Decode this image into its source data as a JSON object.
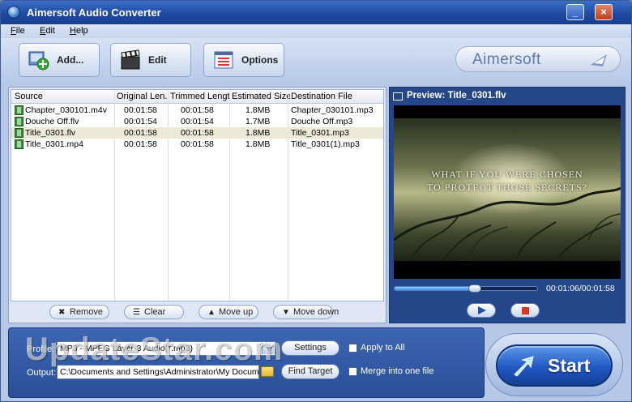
{
  "window": {
    "title": "Aimersoft Audio Converter"
  },
  "menu": [
    "File",
    "Edit",
    "Help"
  ],
  "toolbar": {
    "add_label": "Add...",
    "edit_label": "Edit",
    "options_label": "Options",
    "brand": "Aimersoft"
  },
  "table": {
    "headers": [
      "Source",
      "Original Len...",
      "Trimmed Length",
      "Estimated Size",
      "Destination File"
    ],
    "rows": [
      {
        "source": "Chapter_030101.m4v",
        "original": "00:01:58",
        "trimmed": "00:01:58",
        "size": "1.8MB",
        "dest": "Chapter_030101.mp3",
        "selected": false
      },
      {
        "source": "Douche Off.flv",
        "original": "00:01:54",
        "trimmed": "00:01:54",
        "size": "1.7MB",
        "dest": "Douche Off.mp3",
        "selected": false
      },
      {
        "source": "Title_0301.flv",
        "original": "00:01:58",
        "trimmed": "00:01:58",
        "size": "1.8MB",
        "dest": "Title_0301.mp3",
        "selected": true
      },
      {
        "source": "Title_0301.mp4",
        "original": "00:01:58",
        "trimmed": "00:01:58",
        "size": "1.8MB",
        "dest": "Title_0301(1).mp3",
        "selected": false
      }
    ]
  },
  "actions": {
    "remove": "Remove",
    "clear": "Clear",
    "move_up": "Move up",
    "move_down": "Move down"
  },
  "preview": {
    "title": "Preview: Title_0301.flv",
    "caption_line1": "WHAT IF YOU WERE CHOSEN",
    "caption_line2": "TO PROTECT THOSE SECRETS?",
    "timecode": "00:01:06/00:01:58",
    "progress": 0.56
  },
  "bottom": {
    "profile_label": "Profile:",
    "profile_value": "MP3 - MPEG Layer-3 Audio(*.mp3)",
    "output_label": "Output:",
    "output_value": "C:\\Documents and Settings\\Administrator\\My Documen",
    "settings_label": "Settings",
    "find_target_label": "Find Target",
    "apply_to_all_label": "Apply to All",
    "merge_label": "Merge into one file"
  },
  "start_label": "Start",
  "watermark": "UpdateStar.com",
  "colors": {
    "title_bar": "#1f4aa3",
    "panel": "#2a4f98",
    "stop": "#d8381f"
  }
}
